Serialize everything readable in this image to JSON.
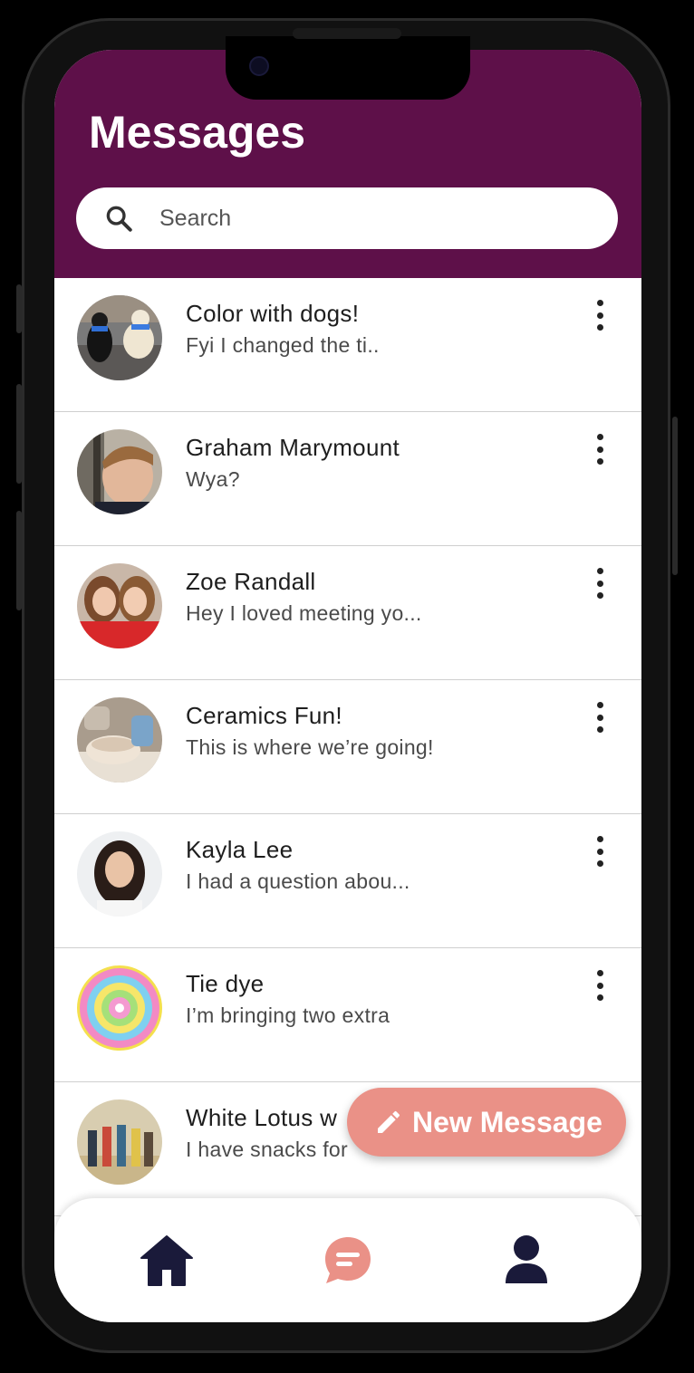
{
  "header": {
    "title": "Messages"
  },
  "search": {
    "placeholder": "Search"
  },
  "conversations": [
    {
      "name": "Color with dogs!",
      "preview": "Fyi I changed the ti.."
    },
    {
      "name": "Graham Marymount",
      "preview": "Wya?"
    },
    {
      "name": "Zoe Randall",
      "preview": "Hey I loved meeting yo..."
    },
    {
      "name": "Ceramics Fun!",
      "preview": "This is where we’re going!"
    },
    {
      "name": "Kayla Lee",
      "preview": "I had a question abou..."
    },
    {
      "name": "Tie dye",
      "preview": "I’m bringing two extra"
    },
    {
      "name": "White Lotus w",
      "preview": "I have snacks for"
    }
  ],
  "fab": {
    "label": "New Message",
    "icon": "pencil-icon"
  },
  "bottom_nav": [
    {
      "name": "home",
      "icon": "home-icon"
    },
    {
      "name": "messages",
      "icon": "chat-bubble-icon",
      "active": true
    },
    {
      "name": "profile",
      "icon": "person-icon"
    }
  ],
  "colors": {
    "header_bg": "#5e1049",
    "accent": "#ea9187",
    "nav_icon": "#1a1a3a"
  }
}
